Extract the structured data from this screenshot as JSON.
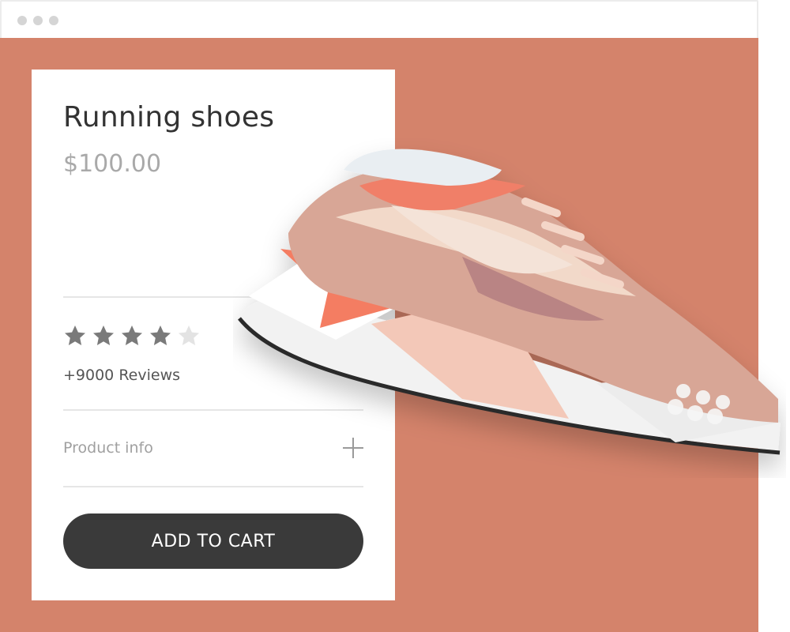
{
  "product": {
    "title": "Running shoes",
    "price": "$100.00",
    "rating": 4,
    "rating_max": 5,
    "reviews": "+9000 Reviews",
    "info_label": "Product info",
    "cta_label": "ADD TO CART"
  },
  "colors": {
    "background": "#d4836b",
    "button": "#3a3a3a",
    "star_filled": "#7a7a7a",
    "star_empty": "#e3e3e3"
  },
  "icons": {
    "star": "star-icon",
    "expand": "plus-icon",
    "window_dots": "window-control-dot"
  }
}
